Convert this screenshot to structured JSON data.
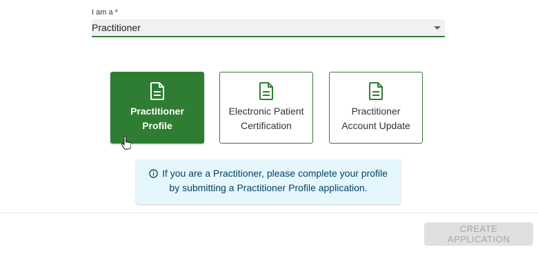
{
  "form": {
    "role_label": "I am a *",
    "role_value": "Practitioner"
  },
  "cards": [
    {
      "label": "Practitioner Profile",
      "icon": "document-icon",
      "selected": true
    },
    {
      "label": "Electronic Patient Certification",
      "icon": "document-icon",
      "selected": false
    },
    {
      "label": "Practitioner Account Update",
      "icon": "document-icon",
      "selected": false
    }
  ],
  "info": {
    "line1": "If you are a Practitioner, please complete your profile",
    "line2": "by submitting a Practitioner Profile application.",
    "icon": "info-icon"
  },
  "actions": {
    "create_label": "CREATE APPLICATION"
  },
  "colors": {
    "accent": "#2e7d32",
    "info_bg": "#e5f6fd",
    "info_text": "#014361",
    "disabled_bg": "#e0e0e0",
    "disabled_text": "#a6a6a6"
  }
}
